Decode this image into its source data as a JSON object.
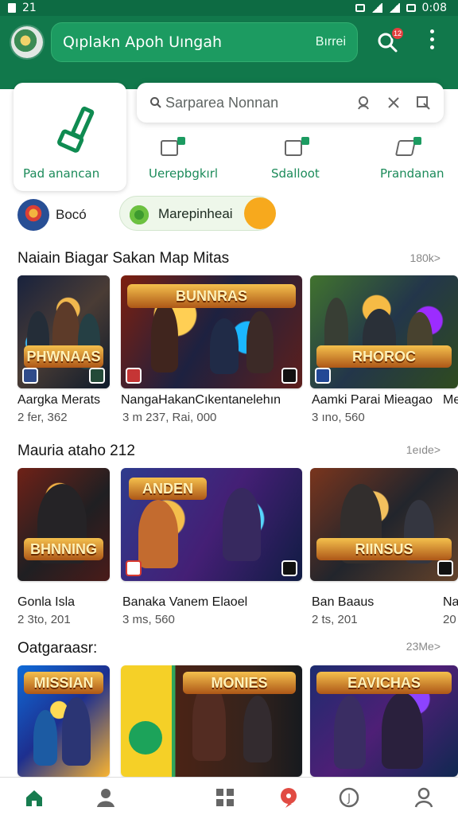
{
  "status_bar": {
    "left_text": "21",
    "time": "0:08"
  },
  "top_search": {
    "text": "Qıplakn Apoh Uıngah",
    "right_text": "Bırrei",
    "badge": "12"
  },
  "category_search": {
    "placeholder": "Sarparea Nonnan"
  },
  "categories": [
    {
      "label": "Pad anancan"
    },
    {
      "label": "Uerepbgkırl"
    },
    {
      "label": "Sdalloot"
    },
    {
      "label": "Prandanan"
    }
  ],
  "chips": {
    "avatar_label": "Bocó",
    "active_label": "Marepinheai"
  },
  "sections": [
    {
      "title": "Naiain Biagar Sakan Map Mitas",
      "see_all": "180k>",
      "cards": [
        {
          "title": "Aargka Merats",
          "meta": "2 fer, 362",
          "art_text": "PHWNAAS"
        },
        {
          "title": "NangaHakanCıkentanelehın",
          "meta": "3 m 237, Rai, 000",
          "art_text": "BUNNRAS"
        },
        {
          "title": "Aamki Parai Mieagao",
          "meta": "3 ıno, 560",
          "art_text": "RHOROC"
        },
        {
          "title": "Me",
          "meta": ""
        }
      ]
    },
    {
      "title": "Mauria ataho 212",
      "see_all": "1eıde>",
      "cards": [
        {
          "title": "Gonla Isla",
          "meta": "2 3to, 201",
          "art_text": "BHNNING"
        },
        {
          "title": "Banaka Vanem Elaoel",
          "meta": "3 ms, 560",
          "art_text": "ANDEN"
        },
        {
          "title": "Ban Baaus",
          "meta": "2 ts, 201",
          "art_text": "RIINSUS"
        },
        {
          "title": "Na",
          "meta": "20"
        }
      ]
    },
    {
      "title": "Oatgaraasr:",
      "see_all": "23Me>",
      "cards": [
        {
          "title": "",
          "meta": "",
          "art_text": "MISSIAN"
        },
        {
          "title": "",
          "meta": "",
          "art_text": "MONIES"
        },
        {
          "title": "",
          "meta": "",
          "art_text": "EAVICHAS"
        }
      ]
    }
  ],
  "icons": {
    "logo": "app-logo",
    "search": "search-icon",
    "more": "more-vert-icon",
    "home": "home-icon",
    "profile": "profile-icon",
    "grid": "grid-icon",
    "notifications": "notification-icon",
    "info": "info-icon",
    "account": "account-icon"
  }
}
